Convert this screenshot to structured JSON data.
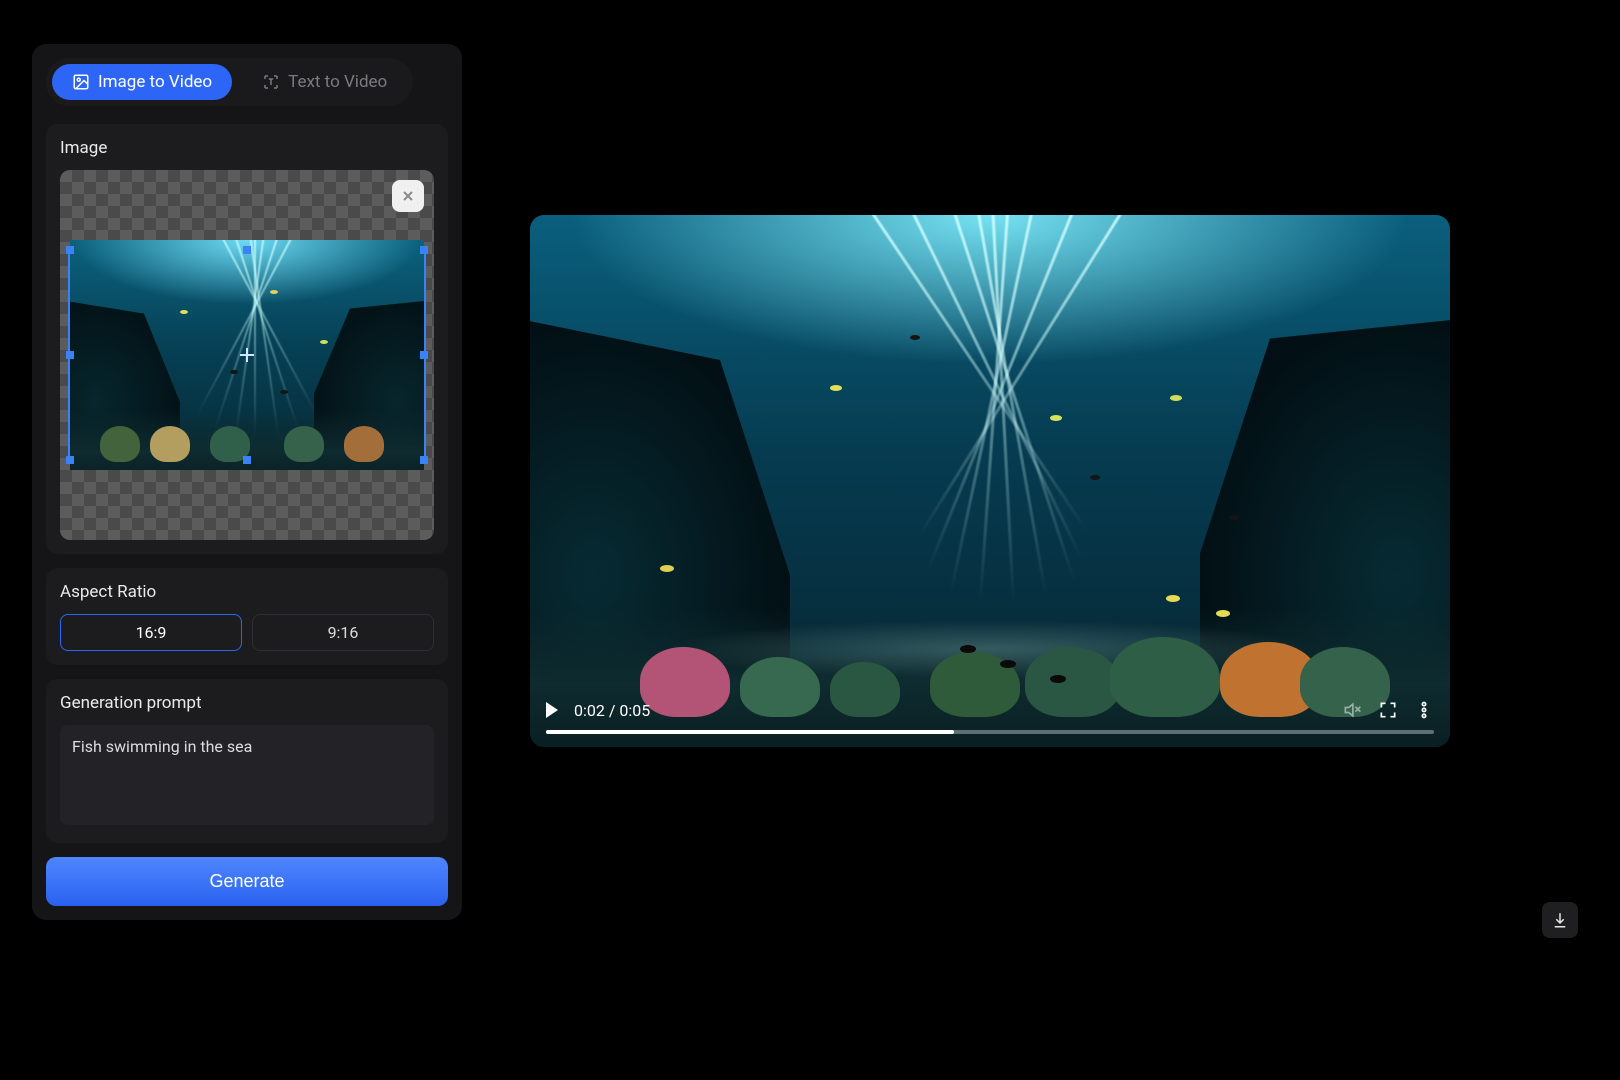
{
  "tabs": {
    "image_to_video": "Image to Video",
    "text_to_video": "Text to Video"
  },
  "image_section": {
    "title": "Image"
  },
  "aspect_ratio": {
    "title": "Aspect Ratio",
    "option_16_9": "16:9",
    "option_9_16": "9:16",
    "selected": "16:9"
  },
  "prompt": {
    "title": "Generation prompt",
    "value": "Fish swimming in the sea"
  },
  "generate_button": "Generate",
  "video": {
    "current_time": "0:02",
    "duration": "0:05",
    "time_label": "0:02 / 0:05",
    "progress_percent": 46
  }
}
